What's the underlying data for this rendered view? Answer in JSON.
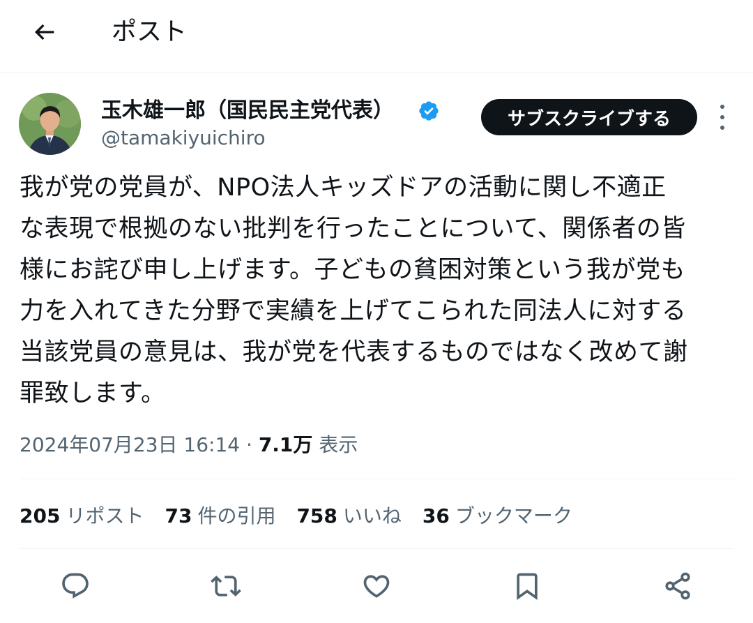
{
  "header": {
    "back_icon": "arrow-left-icon",
    "title": "ポスト"
  },
  "author": {
    "name": "玉木雄一郎（国民民主党代表）",
    "handle": "@tamakiyuichiro",
    "verified_color": "#1d9bf0",
    "subscribe_label": "サブスクライブする"
  },
  "post": {
    "text": "我が党の党員が、NPO法人キッズドアの活動に関し不適正\nな表現で根拠のない批判を行ったことについて、関係者の皆\n様にお詫び申し上げます。子どもの貧困対策という我が党も\n力を入れてきた分野で実績を上げてこられた同法人に対する\n当該党員の意見は、我が党を代表するものではなく改めて謝\n罪致します。",
    "timestamp": "2024年07月23日 16:14",
    "separator": " · ",
    "views_count": "7.1万",
    "views_label": "表示"
  },
  "stats": [
    {
      "count": "205",
      "label": "リポスト"
    },
    {
      "count": "73",
      "label": "件の引用"
    },
    {
      "count": "758",
      "label": "いいね"
    },
    {
      "count": "36",
      "label": "ブックマーク"
    }
  ],
  "actions": [
    "reply-icon",
    "repost-icon",
    "like-icon",
    "bookmark-icon",
    "share-icon"
  ],
  "colors": {
    "text": "#0f1419",
    "secondary": "#536471",
    "accent": "#1d9bf0",
    "divider": "#eff3f4"
  }
}
